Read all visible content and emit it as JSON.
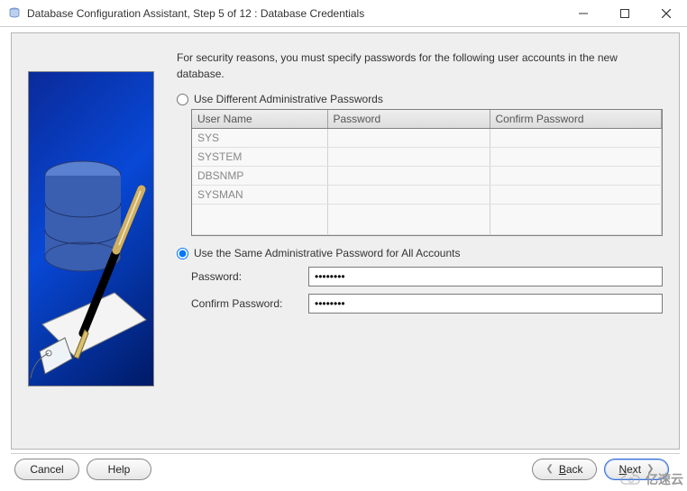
{
  "window": {
    "title": "Database Configuration Assistant, Step 5 of 12 : Database Credentials"
  },
  "instruction": "For security reasons, you must specify passwords for the following user accounts in the new database.",
  "options": {
    "different": {
      "label": "Use Different Administrative Passwords",
      "selected": false
    },
    "same": {
      "label": "Use the Same Administrative Password for All Accounts",
      "selected": true
    }
  },
  "table": {
    "headers": {
      "user": "User Name",
      "password": "Password",
      "confirm": "Confirm Password"
    },
    "rows": [
      {
        "user": "SYS"
      },
      {
        "user": "SYSTEM"
      },
      {
        "user": "DBSNMP"
      },
      {
        "user": "SYSMAN"
      }
    ]
  },
  "form": {
    "password_label": "Password:",
    "confirm_label": "Confirm Password:",
    "password_value": "********",
    "confirm_value": "********"
  },
  "buttons": {
    "cancel": "Cancel",
    "help": "Help",
    "back": "Back",
    "next": "Next",
    "back_key": "B",
    "next_key": "N"
  },
  "watermark": "亿速云"
}
